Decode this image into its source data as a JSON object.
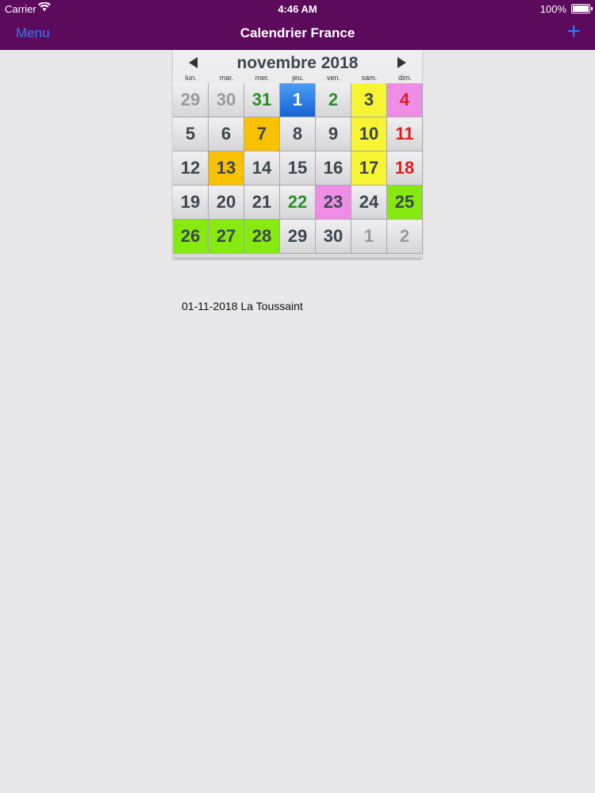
{
  "status": {
    "carrier": "Carrier",
    "time": "4:46 AM",
    "battery": "100%"
  },
  "nav": {
    "menu": "Menu",
    "title": "Calendrier France",
    "add": "+"
  },
  "calendar": {
    "month": "novembre 2018",
    "weekdays": [
      "lun.",
      "mar.",
      "mer.",
      "jeu.",
      "ven.",
      "sam.",
      "dim."
    ],
    "days": [
      {
        "n": "29",
        "cls": "out"
      },
      {
        "n": "30",
        "cls": "out"
      },
      {
        "n": "31",
        "cls": "green"
      },
      {
        "n": "1",
        "cls": "bg-blue"
      },
      {
        "n": "2",
        "cls": "green"
      },
      {
        "n": "3",
        "cls": "bg-yellow"
      },
      {
        "n": "4",
        "cls": "bg-pink red"
      },
      {
        "n": "5",
        "cls": ""
      },
      {
        "n": "6",
        "cls": ""
      },
      {
        "n": "7",
        "cls": "bg-orange"
      },
      {
        "n": "8",
        "cls": ""
      },
      {
        "n": "9",
        "cls": ""
      },
      {
        "n": "10",
        "cls": "bg-yellow"
      },
      {
        "n": "11",
        "cls": "red"
      },
      {
        "n": "12",
        "cls": ""
      },
      {
        "n": "13",
        "cls": "bg-orange"
      },
      {
        "n": "14",
        "cls": ""
      },
      {
        "n": "15",
        "cls": ""
      },
      {
        "n": "16",
        "cls": ""
      },
      {
        "n": "17",
        "cls": "bg-yellow"
      },
      {
        "n": "18",
        "cls": "red"
      },
      {
        "n": "19",
        "cls": ""
      },
      {
        "n": "20",
        "cls": ""
      },
      {
        "n": "21",
        "cls": ""
      },
      {
        "n": "22",
        "cls": "green"
      },
      {
        "n": "23",
        "cls": "bg-pink"
      },
      {
        "n": "24",
        "cls": ""
      },
      {
        "n": "25",
        "cls": "bg-lime"
      },
      {
        "n": "26",
        "cls": "bg-lime"
      },
      {
        "n": "27",
        "cls": "bg-lime"
      },
      {
        "n": "28",
        "cls": "bg-lime"
      },
      {
        "n": "29",
        "cls": ""
      },
      {
        "n": "30",
        "cls": ""
      },
      {
        "n": "1",
        "cls": "out"
      },
      {
        "n": "2",
        "cls": "out"
      }
    ]
  },
  "events": [
    "01-11-2018 La Toussaint"
  ],
  "colors": {
    "navbar": "#5c0a5c",
    "accent": "#2f7cf6",
    "selected": "#1e6fe0",
    "yellow": "#f6f433",
    "pink": "#ee8ce6",
    "orange": "#f8c200",
    "lime": "#86ea10",
    "holiday_text": "#e01e1e",
    "green_text": "#2a8f2a"
  }
}
